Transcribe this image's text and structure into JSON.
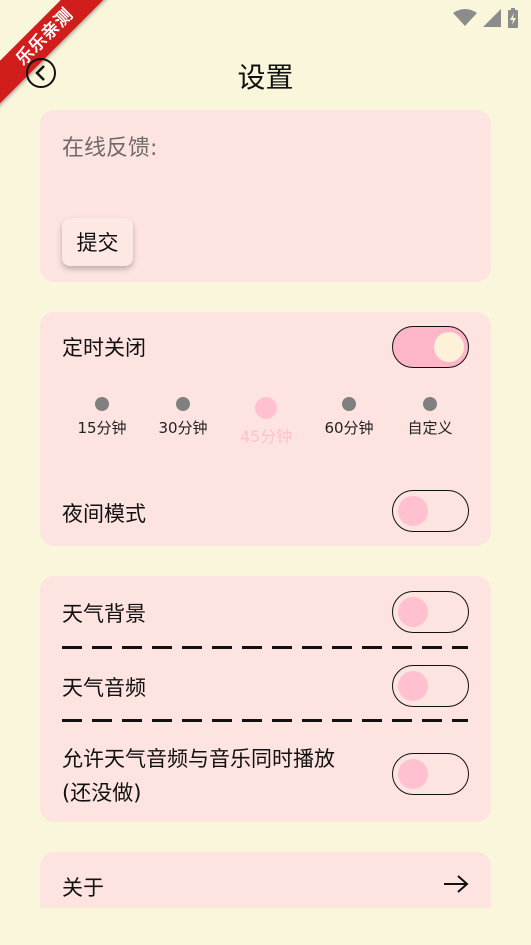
{
  "header": {
    "title": "设置"
  },
  "watermark": "乐乐亲测",
  "feedback": {
    "label": "在线反馈:",
    "submit": "提交"
  },
  "timer": {
    "label": "定时关闭",
    "enabled": true,
    "options": [
      "15分钟",
      "30分钟",
      "45分钟",
      "60分钟",
      "自定义"
    ],
    "selected": "45分钟"
  },
  "night_mode": {
    "label": "夜间模式",
    "enabled": false
  },
  "weather": {
    "background_label": "天气背景",
    "background_enabled": false,
    "audio_label": "天气音频",
    "audio_enabled": false,
    "mix_label_line1": "允许天气音频与音乐同时播放",
    "mix_label_line2": "(还没做)",
    "mix_enabled": false
  },
  "about": {
    "label": "关于"
  },
  "colors": {
    "background": "#f9f6dc",
    "card": "#fde4e0",
    "accent": "#ffb6c8",
    "watermark": "#d21d1d"
  }
}
